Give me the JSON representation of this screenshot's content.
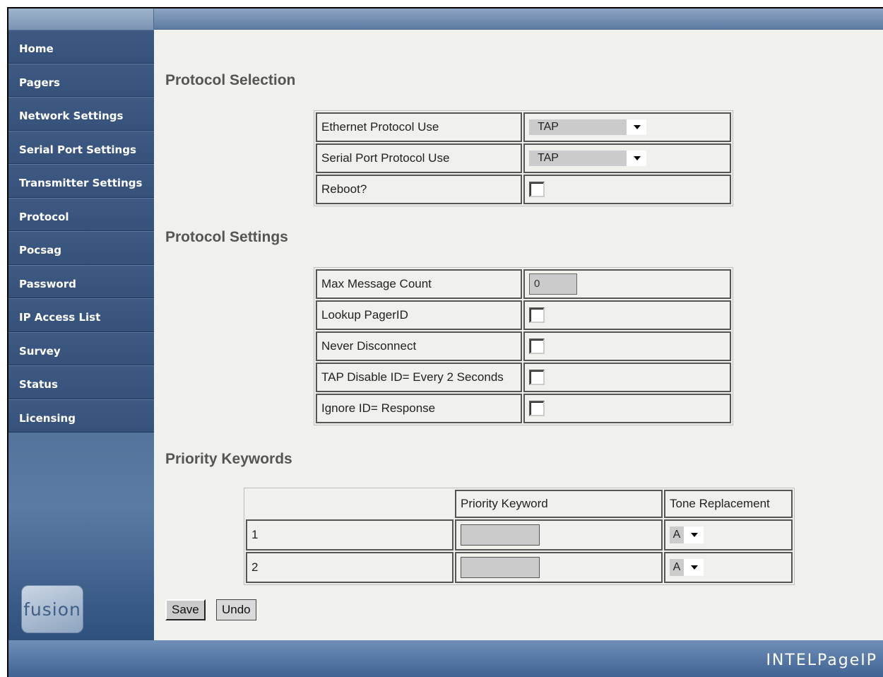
{
  "sidebar": {
    "items": [
      {
        "label": "Home"
      },
      {
        "label": "Pagers"
      },
      {
        "label": "Network Settings"
      },
      {
        "label": "Serial Port Settings"
      },
      {
        "label": "Transmitter Settings"
      },
      {
        "label": "Protocol"
      },
      {
        "label": "Pocsag"
      },
      {
        "label": "Password"
      },
      {
        "label": "IP Access List"
      },
      {
        "label": "Survey"
      },
      {
        "label": "Status"
      },
      {
        "label": "Licensing"
      }
    ],
    "logo_text": "fusion"
  },
  "footer": {
    "brand": "INTELPageIP"
  },
  "protocol_selection": {
    "title": "Protocol Selection",
    "ethernet": {
      "label": "Ethernet Protocol Use",
      "value": "TAP"
    },
    "serial": {
      "label": "Serial Port Protocol Use",
      "value": "TAP"
    },
    "reboot": {
      "label": "Reboot?",
      "checked": false
    }
  },
  "protocol_settings": {
    "title": "Protocol Settings",
    "max_message_count": {
      "label": "Max Message Count",
      "value": "0"
    },
    "lookup_pagerid": {
      "label": "Lookup PagerID",
      "checked": false
    },
    "never_disconnect": {
      "label": "Never Disconnect",
      "checked": false
    },
    "tap_disable_id": {
      "label": "TAP Disable ID= Every 2 Seconds",
      "checked": false
    },
    "ignore_id_response": {
      "label": "Ignore ID= Response",
      "checked": false
    }
  },
  "priority_keywords": {
    "title": "Priority Keywords",
    "headers": {
      "keyword": "Priority Keyword",
      "tone": "Tone Replacement"
    },
    "rows": [
      {
        "index": "1",
        "keyword": "",
        "tone": "A"
      },
      {
        "index": "2",
        "keyword": "",
        "tone": "A"
      }
    ]
  },
  "actions": {
    "save": "Save",
    "undo": "Undo"
  }
}
